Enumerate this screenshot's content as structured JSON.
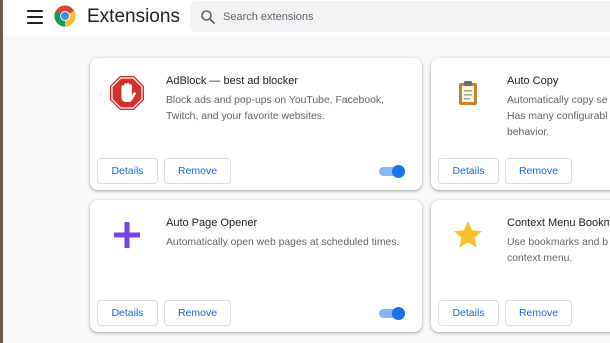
{
  "header": {
    "title": "Extensions",
    "search_placeholder": "Search extensions"
  },
  "extensions": [
    {
      "name": "AdBlock — best ad blocker",
      "description": "Block ads and pop-ups on YouTube, Facebook, Twitch, and your favorite websites.",
      "icon": "adblock-stop-hand-icon",
      "details_label": "Details",
      "remove_label": "Remove",
      "enabled": true
    },
    {
      "name": "Auto Copy",
      "description_lines": [
        "Automatically copy se",
        "Has many configurabl",
        "behavior."
      ],
      "icon": "clipboard-icon",
      "details_label": "Details",
      "remove_label": "Remove"
    },
    {
      "name": "Auto Page Opener",
      "description": "Automatically open web pages at scheduled times.",
      "icon": "plus-icon",
      "details_label": "Details",
      "remove_label": "Remove",
      "enabled": true
    },
    {
      "name": "Context Menu Bookm",
      "description_lines": [
        "Use bookmarks and b",
        "context menu."
      ],
      "icon": "star-icon",
      "details_label": "Details",
      "remove_label": "Remove"
    }
  ],
  "colors": {
    "accent": "#1a73e8",
    "toggle_track": "#8ab4f8",
    "adblock_red": "#d32f2f",
    "plus_purple": "#7b3fe4",
    "star_yellow": "#fbc02d"
  }
}
